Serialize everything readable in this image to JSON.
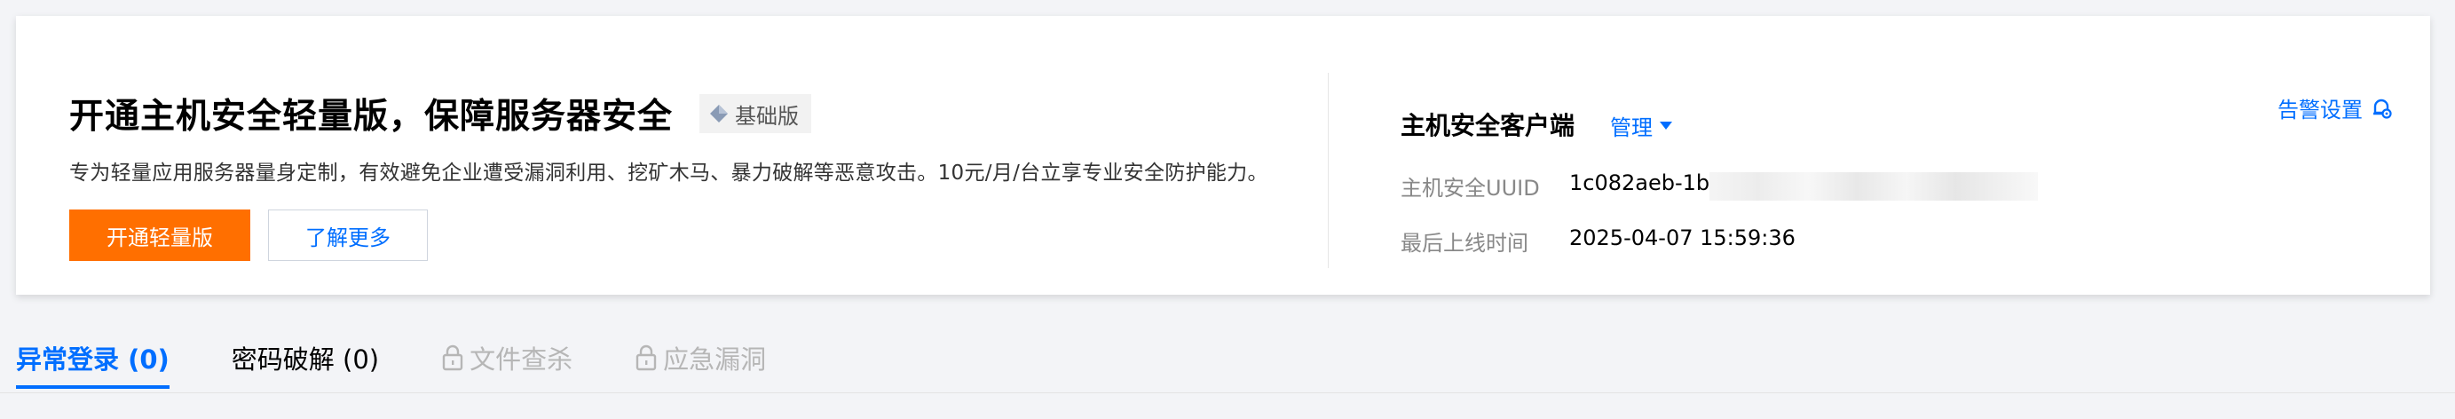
{
  "banner": {
    "title": "开通主机安全轻量版，保障服务器安全",
    "edition_badge": "基础版",
    "description": "专为轻量应用服务器量身定制，有效避免企业遭受漏洞利用、挖矿木马、暴力破解等恶意攻击。10元/月/台立享专业安全防护能力。",
    "primary_button": "开通轻量版",
    "secondary_button": "了解更多"
  },
  "client": {
    "title": "主机安全客户端",
    "manage_label": "管理",
    "uuid_label": "主机安全UUID",
    "uuid_value": "1c082aeb-1b",
    "last_online_label": "最后上线时间",
    "last_online_value": "2025-04-07 15:59:36",
    "alert_settings_label": "告警设置"
  },
  "tabs": [
    {
      "label": "异常登录 (0)",
      "active": true,
      "locked": false
    },
    {
      "label": "密码破解 (0)",
      "active": false,
      "locked": false
    },
    {
      "label": "文件查杀",
      "active": false,
      "locked": true
    },
    {
      "label": "应急漏洞",
      "active": false,
      "locked": true
    }
  ],
  "colors": {
    "primary_orange": "#ff6f00",
    "link_blue": "#006eff",
    "background": "#f3f4f7"
  },
  "icons": {
    "edition": "diamond-icon",
    "manage": "caret-down-icon",
    "alert": "bell-gear-icon",
    "locked_tab": "lock-icon"
  }
}
